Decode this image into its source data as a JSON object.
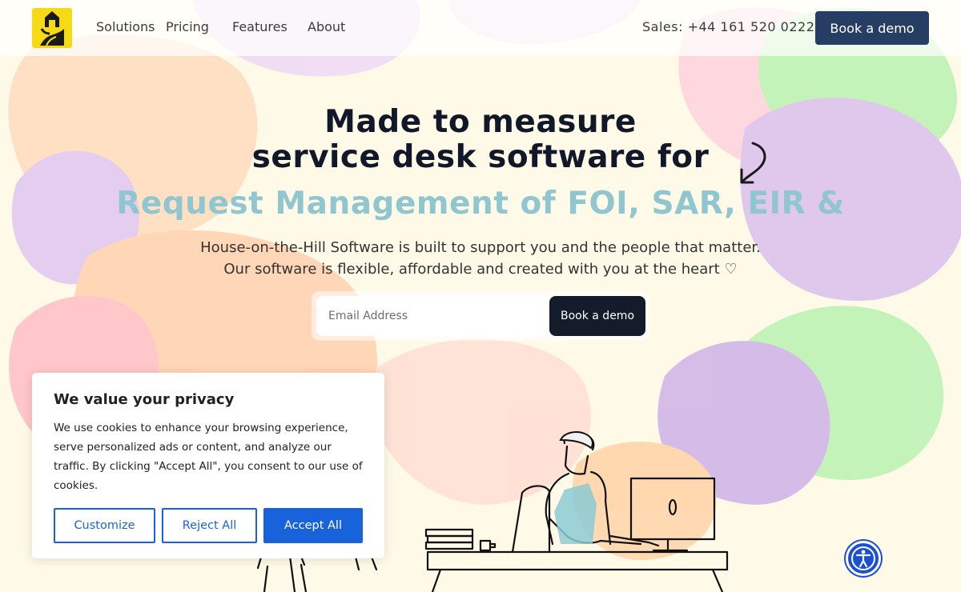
{
  "header": {
    "nav": [
      "Solutions",
      "Pricing",
      "Features",
      "About"
    ],
    "sales": "Sales: +44 161 520 0222",
    "cta": "Book a demo"
  },
  "hero": {
    "title_line1": "Made to measure",
    "title_line2": "service desk software for",
    "rotating_text": "Request Management of FOI, SAR, EIR &",
    "subtitle_line1": "House-on-the-Hill Software is built to support you and the people that matter.",
    "subtitle_line2": "Our software is flexible, affordable and created with you at the heart ♡",
    "email_placeholder": "Email Address",
    "form_cta": "Book a demo"
  },
  "cookie_banner": {
    "title": "We value your privacy",
    "text": "We use cookies to enhance your browsing experience, serve personalized ads or content, and analyze our traffic. By clicking \"Accept All\", you consent to our use of cookies.",
    "customize": "Customize",
    "reject": "Reject All",
    "accept": "Accept All"
  },
  "icons": {
    "logo": "house-on-hill-logo",
    "arrow": "curved-arrow-icon",
    "accessibility": "accessibility-icon"
  },
  "colors": {
    "header_button": "#263e63",
    "rotating_text": "#8fc6d0",
    "cookie_accent": "#1863dc",
    "background": "#fffae8"
  }
}
